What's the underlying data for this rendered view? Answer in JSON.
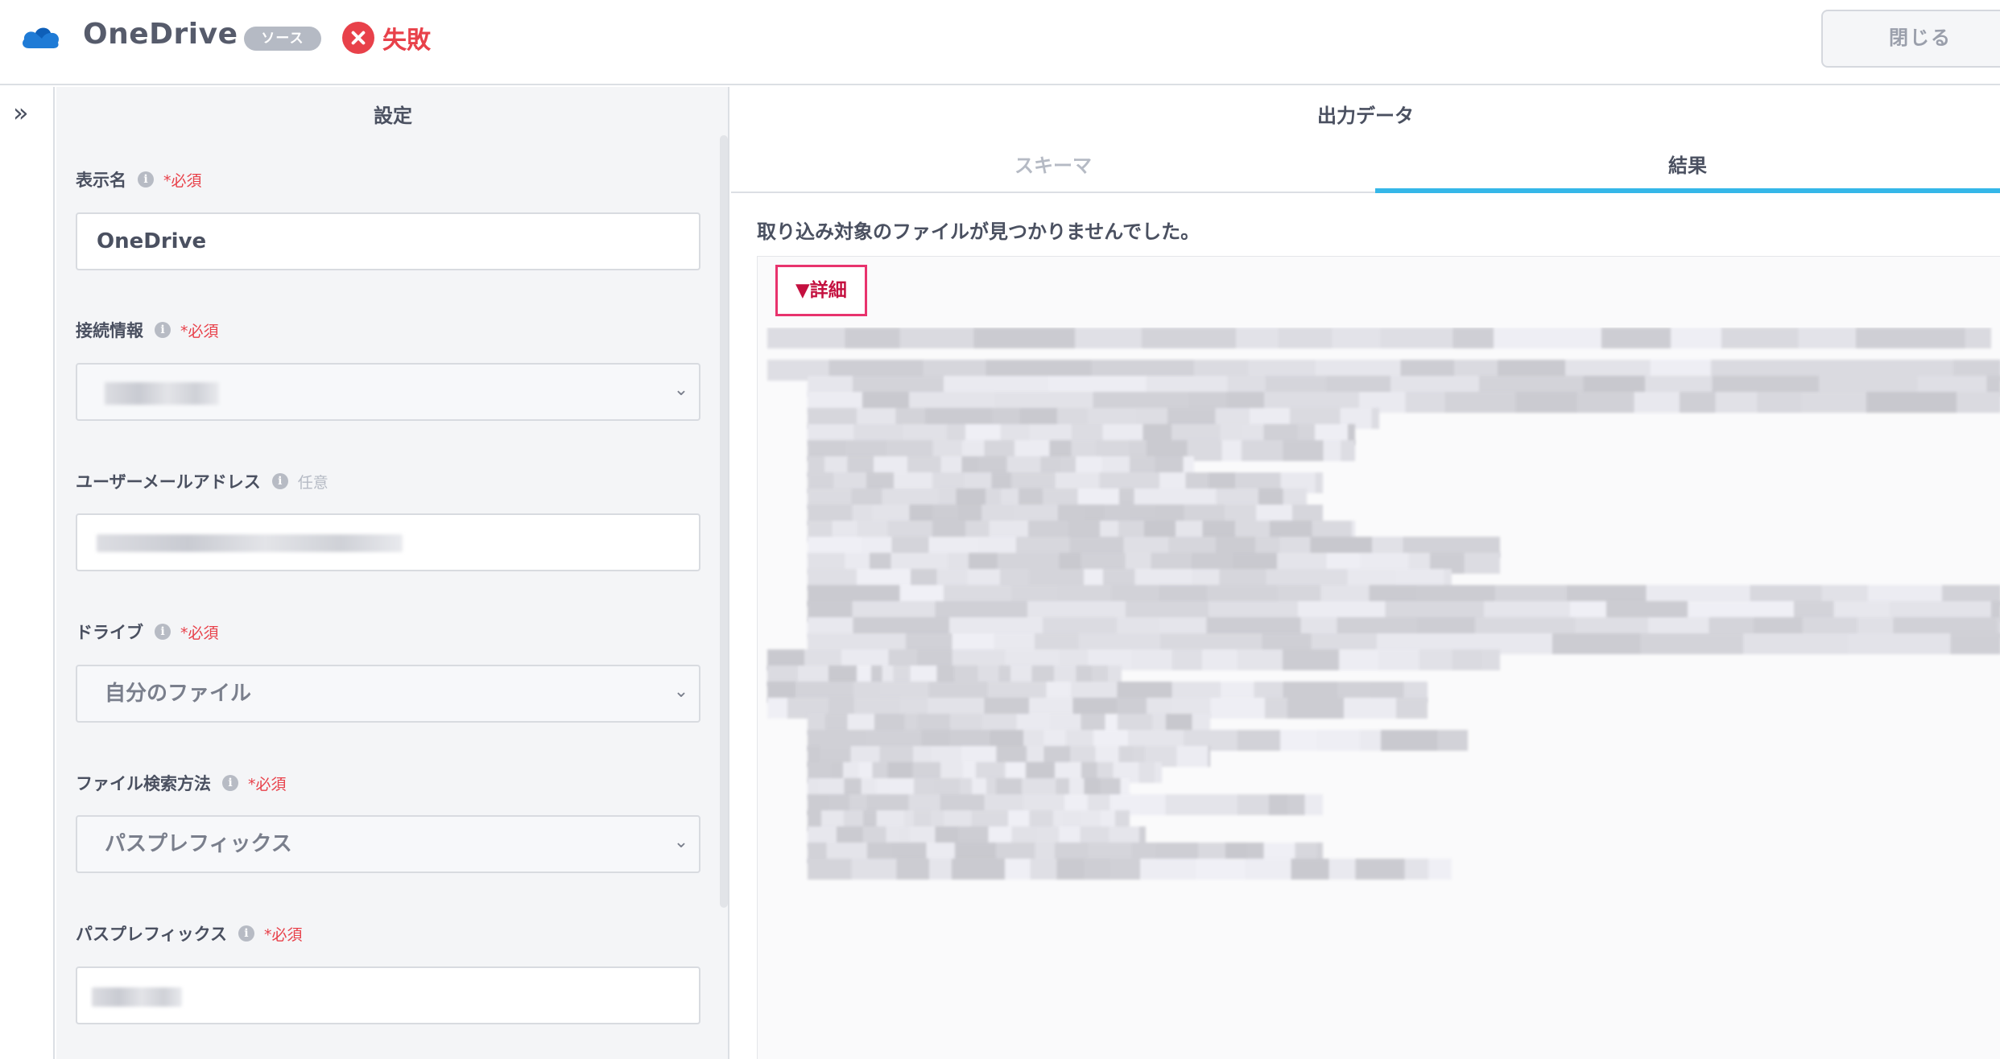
{
  "header": {
    "app_name": "OneDrive",
    "badge": "ソース",
    "status": "失敗",
    "close_label": "閉じる",
    "colors": {
      "status": "#e8414a",
      "logo": "#1f7bd6"
    }
  },
  "rail": {
    "expand_icon": "double-chevron-right-icon"
  },
  "settings": {
    "title": "設定",
    "fields": [
      {
        "label": "表示名",
        "tag": "*必須",
        "value": "OneDrive"
      },
      {
        "label": "接続情報",
        "tag": "*必須"
      },
      {
        "label": "ユーザーメールアドレス",
        "tag": "任意"
      },
      {
        "label": "ドライブ",
        "tag": "*必須",
        "value": "自分のファイル"
      },
      {
        "label": "ファイル検索方法",
        "tag": "*必須",
        "value": "パスプレフィックス"
      },
      {
        "label": "パスプレフィックス",
        "tag": "*必須"
      }
    ]
  },
  "output": {
    "title": "出力データ",
    "tabs": [
      "スキーマ",
      "結果"
    ],
    "active_tab": "結果",
    "message": "取り込み対象のファイルが見つかりませんでした。",
    "details_label": "▼詳細",
    "colors": {
      "tab_active": "#35b7e8",
      "details_border": "#e8336d"
    }
  }
}
